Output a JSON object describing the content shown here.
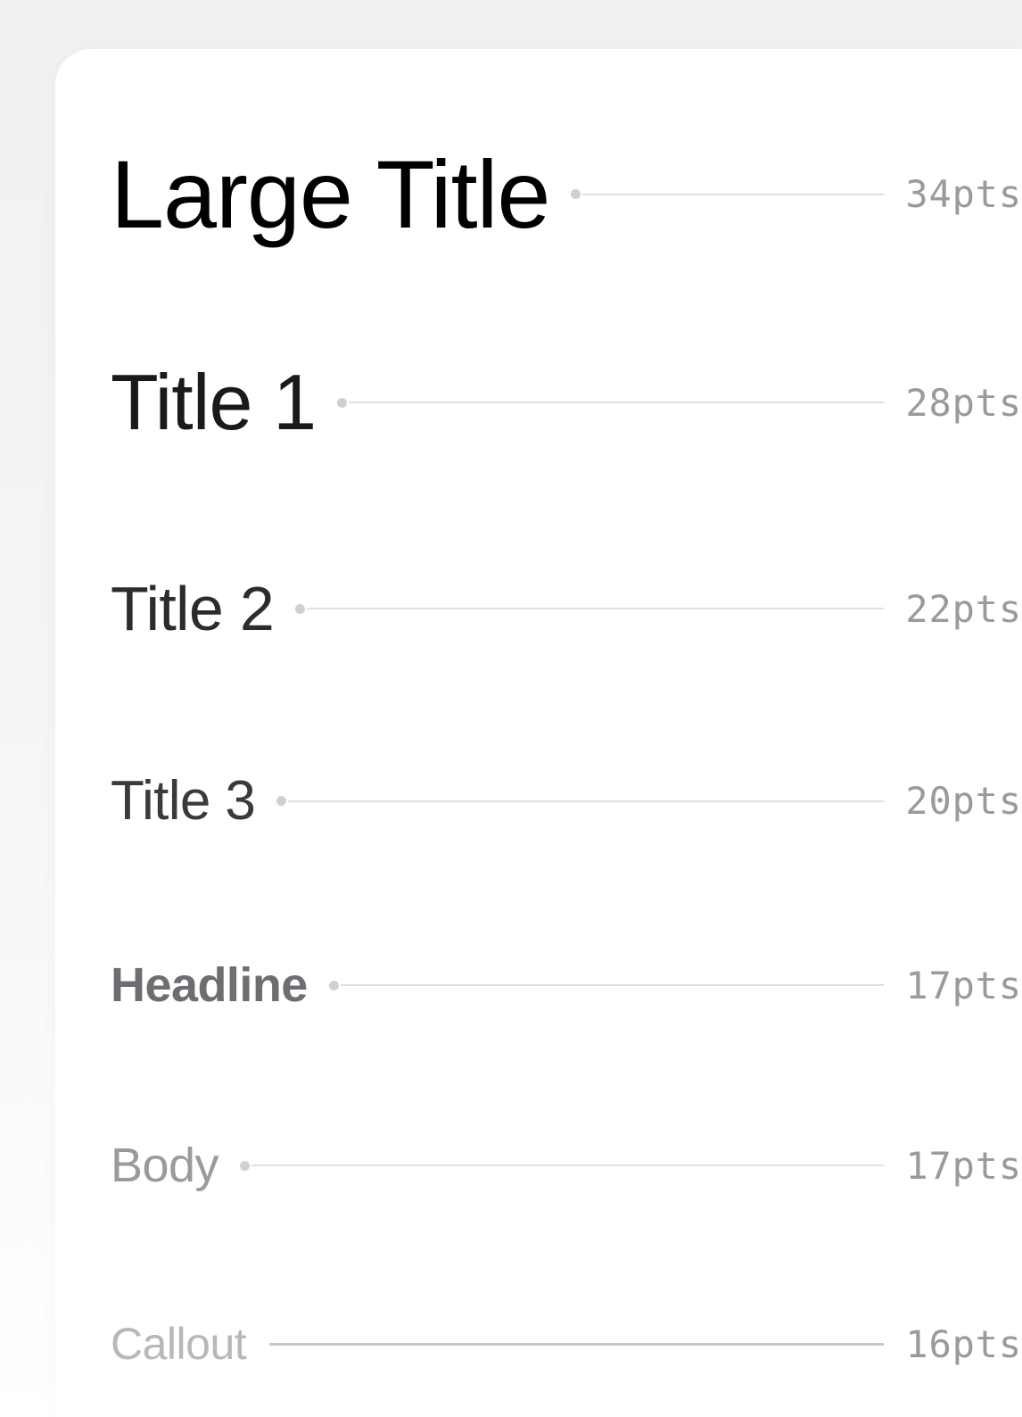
{
  "typography": {
    "rows": [
      {
        "label": "Large Title",
        "size": "34pts"
      },
      {
        "label": "Title 1",
        "size": "28pts"
      },
      {
        "label": "Title 2",
        "size": "22pts"
      },
      {
        "label": "Title 3",
        "size": "20pts"
      },
      {
        "label": "Headline",
        "size": "17pts"
      },
      {
        "label": "Body",
        "size": "17pts"
      },
      {
        "label": "Callout",
        "size": "16pts"
      }
    ]
  }
}
